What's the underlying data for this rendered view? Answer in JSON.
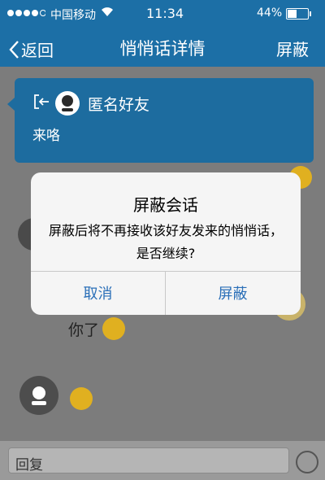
{
  "status_bar": {
    "carrier": "中国移动",
    "time": "11:34",
    "battery": "44%"
  },
  "nav": {
    "back_label": "返回",
    "title": "悄悄话详情",
    "right_label": "屏蔽"
  },
  "chat": {
    "sender_name": "匿名好友",
    "message": "来咯",
    "reply_text": "你了"
  },
  "input": {
    "placeholder": "回复"
  },
  "dialog": {
    "title": "屏蔽会话",
    "message": "屏蔽后将不再接收该好友发来的悄悄话，是否继续?",
    "cancel_label": "取消",
    "confirm_label": "屏蔽"
  },
  "colors": {
    "nav_bg": "#1c6fa6",
    "dialog_button": "#2a6fb8"
  }
}
